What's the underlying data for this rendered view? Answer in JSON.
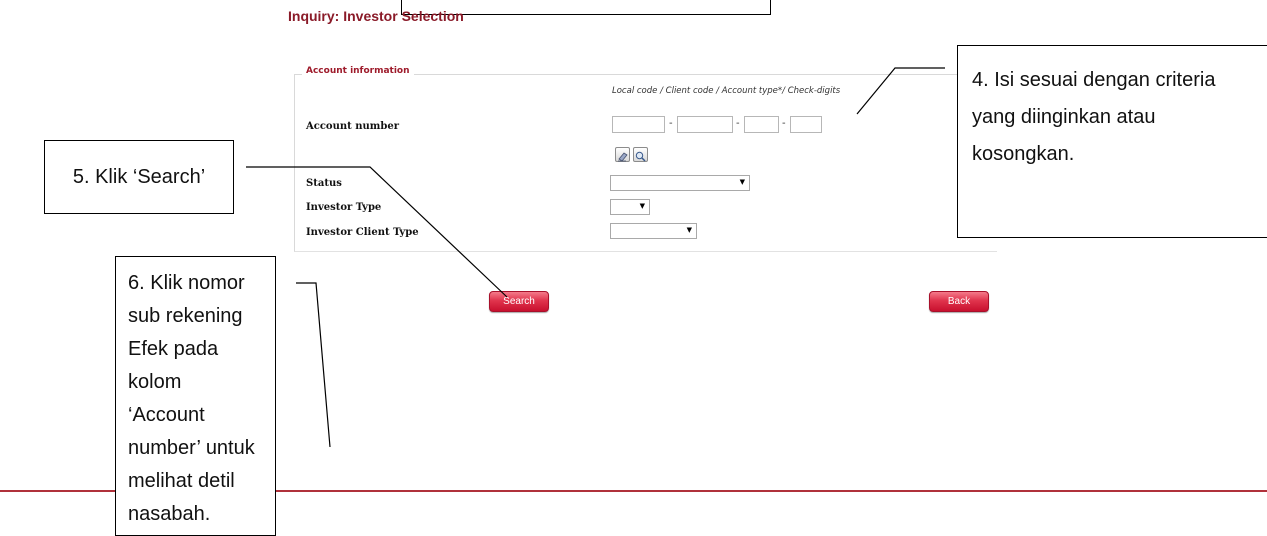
{
  "page": {
    "title": "Inquiry: Investor Selection"
  },
  "form": {
    "section_title": "Account information",
    "account_format_hint": "Local code / Client code / Account type*/ Check-digits",
    "dash": "-",
    "fields": {
      "account_number": {
        "label": "Account number",
        "values": [
          "",
          "",
          "",
          ""
        ]
      },
      "status": {
        "label": "Status",
        "value": ""
      },
      "investor_type": {
        "label": "Investor Type",
        "value": ""
      },
      "investor_client_type": {
        "label": "Investor Client Type",
        "value": ""
      }
    },
    "buttons": {
      "search": "Search",
      "back": "Back"
    },
    "icons": {
      "clear": "eraser-icon",
      "lookup": "magnifier-icon"
    }
  },
  "annotations": {
    "step4": "4. Isi sesuai dengan criteria yang diinginkan atau kosongkan.",
    "step5": "5. Klik ‘Search’",
    "step6": "6. Klik nomor sub rekening Efek pada kolom ‘Account number’ untuk melihat detil nasabah."
  },
  "colors": {
    "title": "#8a1a28",
    "button": "#d42a44",
    "footer_line": "#b0313b"
  }
}
